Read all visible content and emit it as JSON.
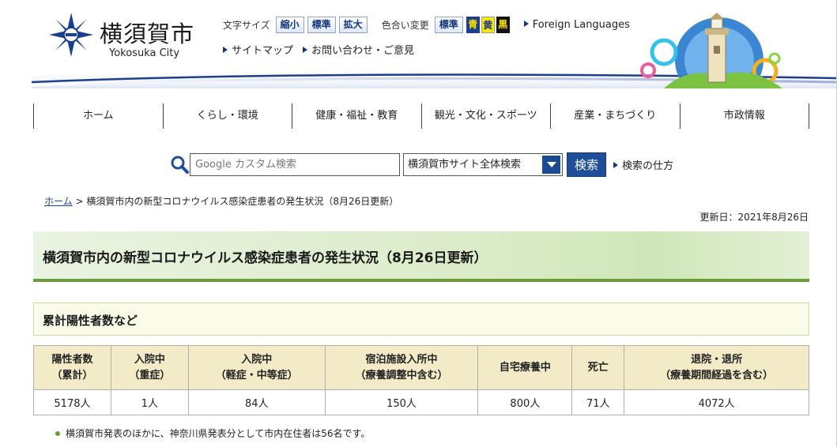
{
  "header": {
    "site_name": "横須賀市",
    "site_name_en": "Yokosuka City",
    "font_size_label": "文字サイズ",
    "font_small": "縮小",
    "font_standard": "標準",
    "font_large": "拡大",
    "color_label": "色合い変更",
    "color_standard": "標準",
    "color_blue": "青",
    "color_yellow": "黄",
    "color_black": "黒",
    "foreign_languages": "Foreign Languages",
    "sitemap": "サイトマップ",
    "contact": "お問い合わせ・ご意見"
  },
  "nav": {
    "items": [
      {
        "label": "ホーム"
      },
      {
        "label": "くらし・環境"
      },
      {
        "label": "健康・福祉・教育"
      },
      {
        "label": "観光・文化・スポーツ"
      },
      {
        "label": "産業・まちづくり"
      },
      {
        "label": "市政情報"
      }
    ]
  },
  "search": {
    "placeholder": "Google カスタム検索",
    "scope": "横須賀市サイト全体検索",
    "button": "検索",
    "help": "検索の仕方"
  },
  "breadcrumb": {
    "home": "ホーム",
    "separator": ">",
    "current": "横須賀市内の新型コロナウイルス感染症患者の発生状況（8月26日更新）"
  },
  "updated": "更新日：2021年8月26日",
  "page_title": "横須賀市内の新型コロナウイルス感染症患者の発生状況（8月26日更新）",
  "section_title": "累計陽性者数など",
  "table": {
    "headers": [
      [
        "陽性者数",
        "（累計）"
      ],
      [
        "入院中",
        "（重症）"
      ],
      [
        "入院中",
        "（軽症・中等症）"
      ],
      [
        "宿泊施設入所中",
        "（療養調整中含む）"
      ],
      [
        "自宅療養中",
        ""
      ],
      [
        "死亡",
        ""
      ],
      [
        "退院・退所",
        "（療養期間経過を含む）"
      ]
    ],
    "values": [
      "5178人",
      "1人",
      "84人",
      "150人",
      "800人",
      "71人",
      "4072人"
    ]
  },
  "note": "横須賀市発表のほかに、神奈川県発表分として市内在住者は56名です。",
  "colors": {
    "accent_blue": "#1f4f99",
    "title_green": "#6e9b3a",
    "table_header": "#f3ebc8"
  }
}
